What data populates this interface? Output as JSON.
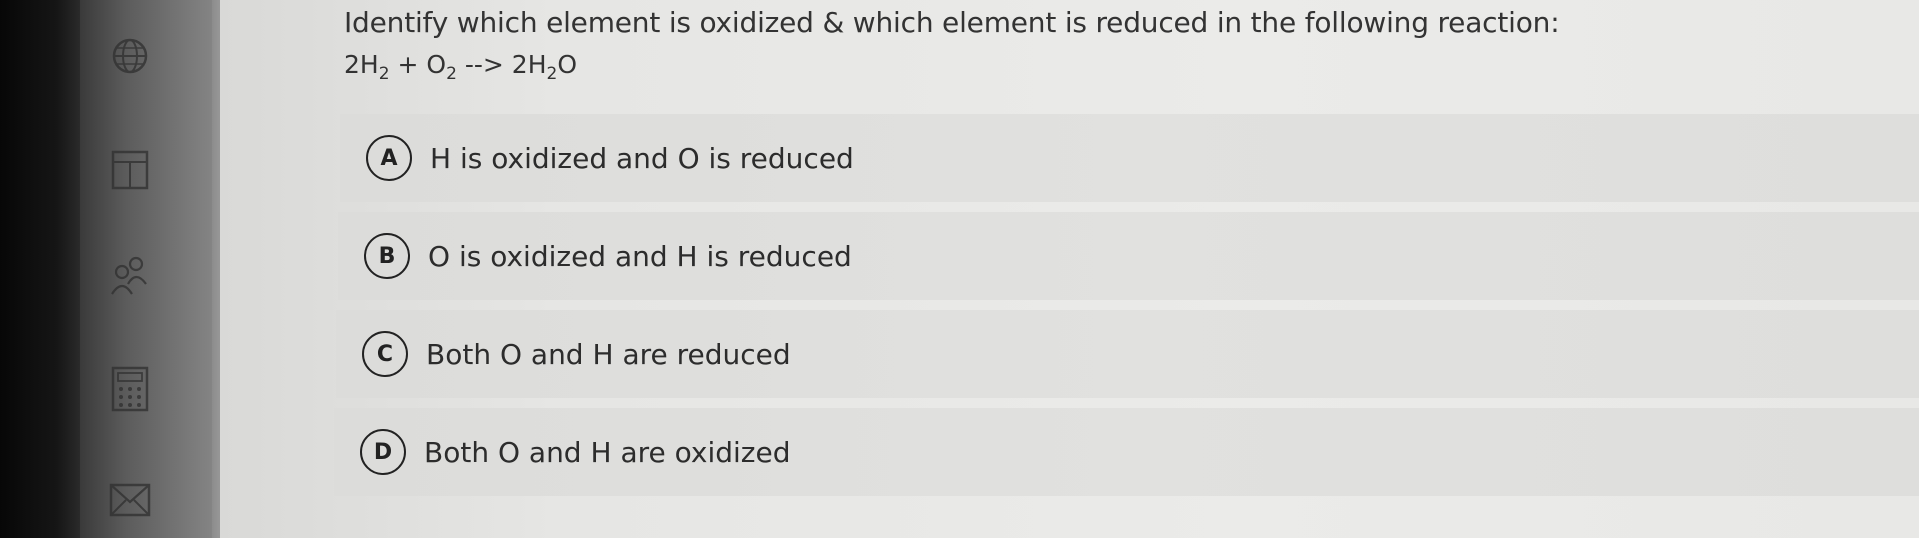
{
  "question": {
    "text": "Identify which element is oxidized & which element is reduced in the following reaction:",
    "equation": {
      "coef1": "2H",
      "sub1": "2",
      "plus": " + O",
      "sub2": "2",
      "arrow": " --> 2H",
      "sub3": "2",
      "tail": "O"
    }
  },
  "options": [
    {
      "letter": "A",
      "text": "H is oxidized and O is reduced"
    },
    {
      "letter": "B",
      "text": "O is oxidized and H is reduced"
    },
    {
      "letter": "C",
      "text": "Both O and H are reduced"
    },
    {
      "letter": "D",
      "text": "Both O and H are oxidized"
    }
  ],
  "sidebar": {
    "icons": [
      "globe-icon",
      "calendar-icon",
      "people-icon",
      "calculator-icon",
      "mail-icon"
    ]
  },
  "colors": {
    "text": "#333333",
    "circle_border": "#222222",
    "option_bg": "#e0e0de"
  }
}
